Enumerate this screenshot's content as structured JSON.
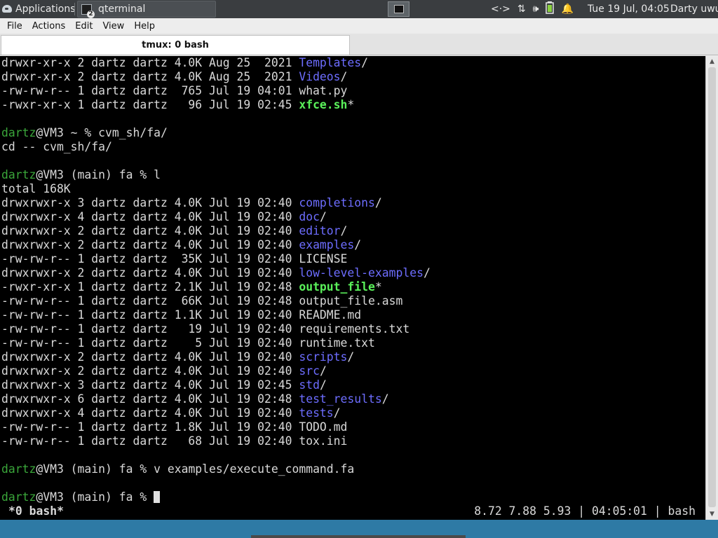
{
  "panel": {
    "applications_label": "Applications",
    "task_label": "qterminal",
    "task_badge": "2",
    "clock": "Tue 19 Jul, 04:05",
    "user": "Darty uwu",
    "tray_icons": [
      "network-arrows-icon",
      "updown-icon",
      "volume-icon",
      "battery-icon",
      "bell-icon"
    ]
  },
  "menu": [
    "File",
    "Actions",
    "Edit",
    "View",
    "Help"
  ],
  "tab": {
    "title": "tmux: 0 bash"
  },
  "terminal": {
    "lines": [
      {
        "parts": [
          {
            "t": "drwxr-xr-x 2 dartz dartz 4.0K Aug 25  2021 "
          },
          {
            "t": "Templates",
            "c": "dir"
          },
          {
            "t": "/"
          }
        ]
      },
      {
        "parts": [
          {
            "t": "drwxr-xr-x 2 dartz dartz 4.0K Aug 25  2021 "
          },
          {
            "t": "Videos",
            "c": "dir"
          },
          {
            "t": "/"
          }
        ]
      },
      {
        "parts": [
          {
            "t": "-rw-rw-r-- 1 dartz dartz  765 Jul 19 04:01 what.py"
          }
        ]
      },
      {
        "parts": [
          {
            "t": "-rwxr-xr-x 1 dartz dartz   96 Jul 19 02:45 "
          },
          {
            "t": "xfce.sh",
            "c": "exe"
          },
          {
            "t": "*"
          }
        ]
      },
      {
        "parts": [
          {
            "t": ""
          }
        ]
      },
      {
        "parts": [
          {
            "t": "dartz",
            "c": "prompt"
          },
          {
            "t": "@VM3 ~ % cvm_sh/fa/"
          }
        ]
      },
      {
        "parts": [
          {
            "t": "cd -- cvm_sh/fa/"
          }
        ]
      },
      {
        "parts": [
          {
            "t": ""
          }
        ]
      },
      {
        "parts": [
          {
            "t": "dartz",
            "c": "prompt"
          },
          {
            "t": "@VM3 (main) fa % l"
          }
        ]
      },
      {
        "parts": [
          {
            "t": "total 168K"
          }
        ]
      },
      {
        "parts": [
          {
            "t": "drwxrwxr-x 3 dartz dartz 4.0K Jul 19 02:40 "
          },
          {
            "t": "completions",
            "c": "dir"
          },
          {
            "t": "/"
          }
        ]
      },
      {
        "parts": [
          {
            "t": "drwxrwxr-x 4 dartz dartz 4.0K Jul 19 02:40 "
          },
          {
            "t": "doc",
            "c": "dir"
          },
          {
            "t": "/"
          }
        ]
      },
      {
        "parts": [
          {
            "t": "drwxrwxr-x 2 dartz dartz 4.0K Jul 19 02:40 "
          },
          {
            "t": "editor",
            "c": "dir"
          },
          {
            "t": "/"
          }
        ]
      },
      {
        "parts": [
          {
            "t": "drwxrwxr-x 2 dartz dartz 4.0K Jul 19 02:40 "
          },
          {
            "t": "examples",
            "c": "dir"
          },
          {
            "t": "/"
          }
        ]
      },
      {
        "parts": [
          {
            "t": "-rw-rw-r-- 1 dartz dartz  35K Jul 19 02:40 LICENSE"
          }
        ]
      },
      {
        "parts": [
          {
            "t": "drwxrwxr-x 2 dartz dartz 4.0K Jul 19 02:40 "
          },
          {
            "t": "low-level-examples",
            "c": "dir"
          },
          {
            "t": "/"
          }
        ]
      },
      {
        "parts": [
          {
            "t": "-rwxr-xr-x 1 dartz dartz 2.1K Jul 19 02:48 "
          },
          {
            "t": "output_file",
            "c": "exe"
          },
          {
            "t": "*"
          }
        ]
      },
      {
        "parts": [
          {
            "t": "-rw-rw-r-- 1 dartz dartz  66K Jul 19 02:48 output_file.asm"
          }
        ]
      },
      {
        "parts": [
          {
            "t": "-rw-rw-r-- 1 dartz dartz 1.1K Jul 19 02:40 README.md"
          }
        ]
      },
      {
        "parts": [
          {
            "t": "-rw-rw-r-- 1 dartz dartz   19 Jul 19 02:40 requirements.txt"
          }
        ]
      },
      {
        "parts": [
          {
            "t": "-rw-rw-r-- 1 dartz dartz    5 Jul 19 02:40 runtime.txt"
          }
        ]
      },
      {
        "parts": [
          {
            "t": "drwxrwxr-x 2 dartz dartz 4.0K Jul 19 02:40 "
          },
          {
            "t": "scripts",
            "c": "dir"
          },
          {
            "t": "/"
          }
        ]
      },
      {
        "parts": [
          {
            "t": "drwxrwxr-x 2 dartz dartz 4.0K Jul 19 02:40 "
          },
          {
            "t": "src",
            "c": "dir"
          },
          {
            "t": "/"
          }
        ]
      },
      {
        "parts": [
          {
            "t": "drwxrwxr-x 3 dartz dartz 4.0K Jul 19 02:45 "
          },
          {
            "t": "std",
            "c": "dir"
          },
          {
            "t": "/"
          }
        ]
      },
      {
        "parts": [
          {
            "t": "drwxrwxr-x 6 dartz dartz 4.0K Jul 19 02:48 "
          },
          {
            "t": "test_results",
            "c": "dir"
          },
          {
            "t": "/"
          }
        ]
      },
      {
        "parts": [
          {
            "t": "drwxrwxr-x 4 dartz dartz 4.0K Jul 19 02:40 "
          },
          {
            "t": "tests",
            "c": "dir"
          },
          {
            "t": "/"
          }
        ]
      },
      {
        "parts": [
          {
            "t": "-rw-rw-r-- 1 dartz dartz 1.8K Jul 19 02:40 TODO.md"
          }
        ]
      },
      {
        "parts": [
          {
            "t": "-rw-rw-r-- 1 dartz dartz   68 Jul 19 02:40 tox.ini"
          }
        ]
      },
      {
        "parts": [
          {
            "t": ""
          }
        ]
      },
      {
        "parts": [
          {
            "t": "dartz",
            "c": "prompt"
          },
          {
            "t": "@VM3 (main) fa % v examples/execute_command.fa"
          }
        ]
      },
      {
        "parts": [
          {
            "t": ""
          }
        ]
      },
      {
        "parts": [
          {
            "t": "dartz",
            "c": "prompt"
          },
          {
            "t": "@VM3 (main) fa % "
          }
        ],
        "cursor": true
      }
    ],
    "status_left": "*0 bash*",
    "status_right": "8.72 7.88 5.93 | 04:05:01 | bash"
  },
  "colors": {
    "dir": "#6d6dff",
    "exe": "#5af05a",
    "prompt": "#3aa63a",
    "panel_bg": "#3a3d40"
  }
}
